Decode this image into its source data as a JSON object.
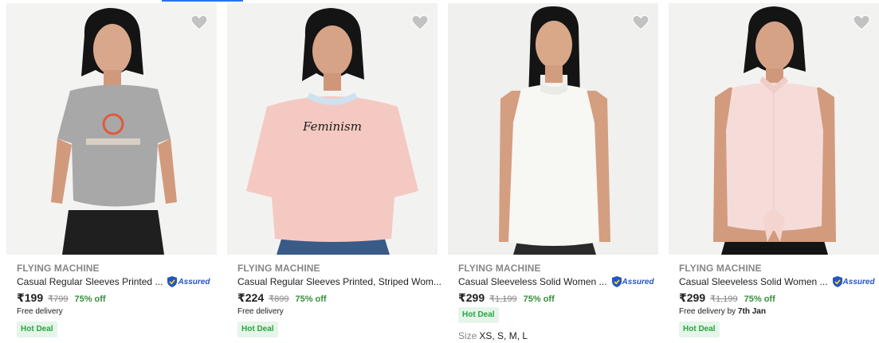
{
  "products": [
    {
      "brand": "FLYING MACHINE",
      "title": "Casual Regular Sleeves Printed ...",
      "assured": "Assured",
      "price": "₹199",
      "mrp": "₹799",
      "discount": "75% off",
      "delivery": "Free delivery",
      "deal": "Hot Deal",
      "image_icon": "tshirt-grey-printed",
      "shirt_color": "#a8a8a8",
      "bottom_color": "#1f1f1f"
    },
    {
      "brand": "FLYING MACHINE",
      "title": "Casual Regular Sleeves Printed, Striped Wom...",
      "price": "₹224",
      "mrp": "₹899",
      "discount": "75% off",
      "delivery": "Free delivery",
      "deal": "Hot Deal",
      "image_icon": "tshirt-pink-feminism",
      "shirt_color": "#f4c9c2",
      "bottom_color": "#3a5a88",
      "print_text": "Feminism"
    },
    {
      "brand": "FLYING MACHINE",
      "title": "Casual Sleeveless Solid Women ...",
      "assured": "Assured",
      "price": "₹299",
      "mrp": "₹1,199",
      "discount": "75% off",
      "deal": "Hot Deal",
      "size_label": "Size",
      "sizes": "XS, S, M, L",
      "image_icon": "top-white-sleeveless",
      "shirt_color": "#f7f7f4",
      "bottom_color": "#2a2a2a"
    },
    {
      "brand": "FLYING MACHINE",
      "title": "Casual Sleeveless Solid Women ...",
      "assured": "Assured",
      "price": "₹299",
      "mrp": "₹1,199",
      "discount": "75% off",
      "delivery_prefix": "Free delivery by",
      "delivery_date": "7th Jan",
      "deal": "Hot Deal",
      "image_icon": "top-pink-sleeveless-shirt",
      "shirt_color": "#f6dcd8",
      "bottom_color": "#141414"
    }
  ],
  "colors": {
    "accent": "#2874f0",
    "discount_green": "#388e3c",
    "deal_green": "#26a541",
    "assured_blue": "#2455c3",
    "wishlist_grey": "#c2c2c2"
  }
}
